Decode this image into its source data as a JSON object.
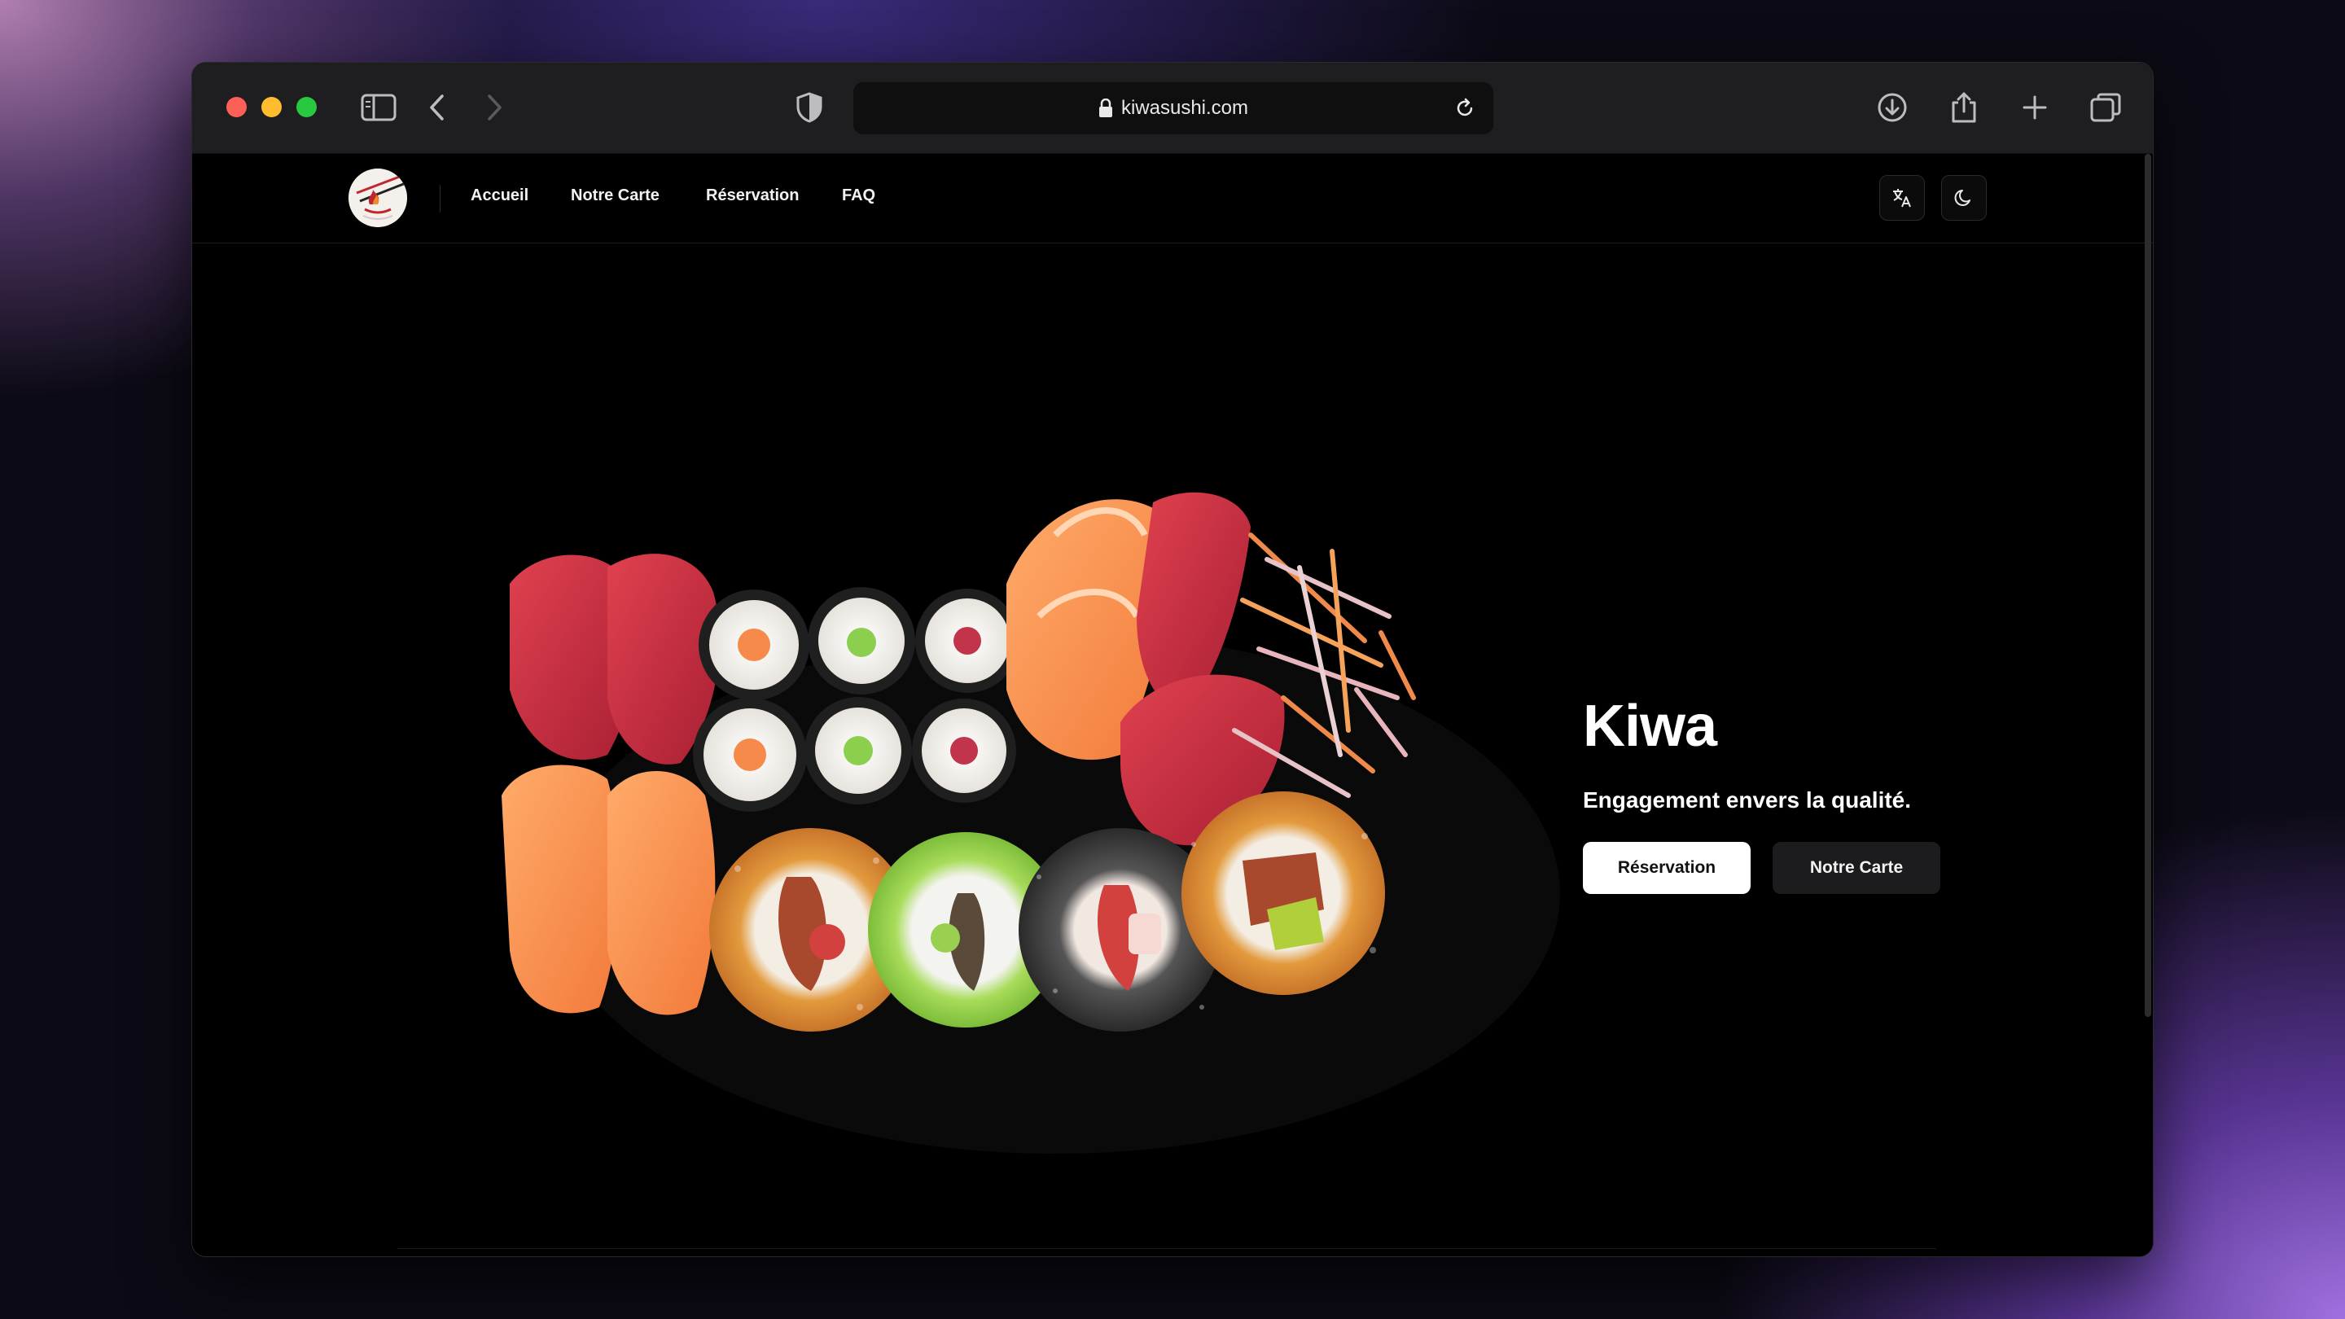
{
  "browser": {
    "url": "kiwasushi.com",
    "icons": {
      "sidebar": "sidebar-icon",
      "back": "chevron-left-icon",
      "forward": "chevron-right-icon",
      "shield": "shield-icon",
      "lock": "lock-icon",
      "reload": "reload-icon",
      "download": "download-icon",
      "share": "share-icon",
      "new_tab": "plus-icon",
      "tabs": "tabs-overview-icon"
    }
  },
  "nav": {
    "links": [
      "Accueil",
      "Notre Carte",
      "Réservation",
      "FAQ"
    ],
    "translate_icon": "translate-icon",
    "theme_icon": "moon-icon"
  },
  "hero": {
    "title": "Kiwa",
    "subtitle": "Engagement envers la qualité.",
    "primary_button": "Réservation",
    "secondary_button": "Notre Carte"
  },
  "colors": {
    "accent_white": "#ffffff",
    "background": "#000000",
    "traffic_red": "#fe5f57",
    "traffic_yellow": "#febc2e",
    "traffic_green": "#28c840"
  }
}
